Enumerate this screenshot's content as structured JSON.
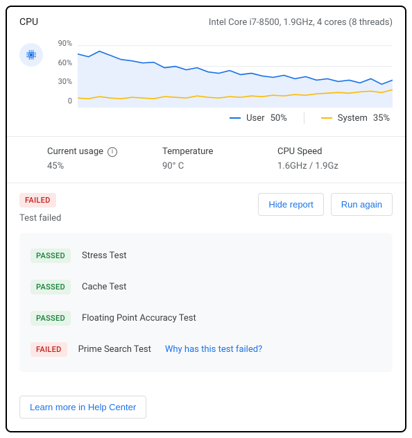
{
  "header": {
    "title": "CPU",
    "subtitle": "Intel Core i7-8500, 1.9GHz, 4 cores (8 threads)"
  },
  "chart_data": {
    "type": "line",
    "ylabel": "",
    "yticks": [
      "90%",
      "60%",
      "30%",
      "0"
    ],
    "ylim": [
      0,
      100
    ],
    "x": [
      0,
      1,
      2,
      3,
      4,
      5,
      6,
      7,
      8,
      9,
      10,
      11,
      12,
      13,
      14,
      15,
      16,
      17,
      18,
      19,
      20,
      21,
      22,
      23,
      24,
      25,
      26,
      27,
      28,
      29
    ],
    "series": [
      {
        "name": "User",
        "legend_value": "50%",
        "color": "#1a73e8",
        "values": [
          78,
          74,
          82,
          76,
          70,
          68,
          65,
          66,
          58,
          60,
          55,
          58,
          52,
          50,
          54,
          48,
          50,
          46,
          44,
          47,
          42,
          45,
          40,
          42,
          38,
          40,
          36,
          42,
          34,
          40
        ]
      },
      {
        "name": "System",
        "legend_value": "35%",
        "color": "#fbbc04",
        "values": [
          14,
          13,
          16,
          14,
          13,
          15,
          14,
          13,
          16,
          15,
          14,
          17,
          15,
          14,
          16,
          15,
          17,
          16,
          18,
          17,
          19,
          18,
          20,
          21,
          22,
          21,
          23,
          24,
          22,
          26
        ]
      }
    ]
  },
  "legend": {
    "user_label": "User",
    "user_value": "50%",
    "system_label": "System",
    "system_value": "35%"
  },
  "stats": {
    "current_usage_label": "Current usage",
    "current_usage_value": "45%",
    "temperature_label": "Temperature",
    "temperature_value": "90° C",
    "cpu_speed_label": "CPU Speed",
    "cpu_speed_value": "1.6GHz / 1.9Gz"
  },
  "test_summary": {
    "badge": "FAILED",
    "status_text": "Test failed",
    "hide_report_label": "Hide report",
    "run_again_label": "Run again"
  },
  "tests": [
    {
      "badge": "PASSED",
      "name": "Stress Test",
      "link": ""
    },
    {
      "badge": "PASSED",
      "name": "Cache Test",
      "link": ""
    },
    {
      "badge": "PASSED",
      "name": "Floating Point Accuracy Test",
      "link": ""
    },
    {
      "badge": "FAILED",
      "name": "Prime Search Test",
      "link": "Why has this test failed?"
    }
  ],
  "footer": {
    "help_center_label": "Learn more in Help Center"
  },
  "colors": {
    "user": "#1a73e8",
    "system": "#fbbc04"
  }
}
